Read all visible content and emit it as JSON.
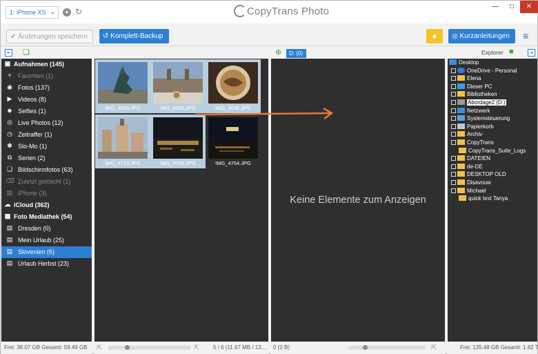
{
  "titlebar": {
    "device": "1: iPhone XS",
    "app_title": "CopyTrans Photo"
  },
  "toolbar": {
    "save_label": "Änderungen speichern",
    "backup_label": "Komplett-Backup",
    "guides_label": "Kurzanleitungen"
  },
  "dest_tab": "D: (0)",
  "explorer_label": "Explorer",
  "left_list": [
    {
      "label": "Aufnahmen (145)",
      "icon": "camera-roll-icon",
      "style": "bold"
    },
    {
      "label": "Favoriten (1)",
      "icon": "heart-icon",
      "style": "dim"
    },
    {
      "label": "Fotos (137)",
      "icon": "camera-icon",
      "style": "normal"
    },
    {
      "label": "Videos (8)",
      "icon": "video-icon",
      "style": "normal"
    },
    {
      "label": "Selfies (1)",
      "icon": "selfie-icon",
      "style": "normal"
    },
    {
      "label": "Live Photos (12)",
      "icon": "live-photo-icon",
      "style": "normal"
    },
    {
      "label": "Zeitraffer (1)",
      "icon": "timelapse-icon",
      "style": "normal"
    },
    {
      "label": "Slo-Mo (1)",
      "icon": "slomo-icon",
      "style": "normal"
    },
    {
      "label": "Serien (2)",
      "icon": "burst-icon",
      "style": "normal"
    },
    {
      "label": "Bildschirmfotos (63)",
      "icon": "screenshot-icon",
      "style": "normal"
    },
    {
      "label": "Zuletzt gelöscht (1)",
      "icon": "trash-icon",
      "style": "dim"
    },
    {
      "label": "iPhone (3)",
      "icon": "album-icon",
      "style": "dim"
    },
    {
      "label": "iCloud (362)",
      "icon": "cloud-icon",
      "style": "bold"
    },
    {
      "label": "Foto Mediathek (54)",
      "icon": "library-icon",
      "style": "bold"
    },
    {
      "label": "Dresden (0)",
      "icon": "album-icon",
      "style": "normal"
    },
    {
      "label": "Mein Urlaub (25)",
      "icon": "album-icon",
      "style": "normal"
    },
    {
      "label": "Slovenien (6)",
      "icon": "album-icon",
      "style": "selected"
    },
    {
      "label": "Urlaub Herbst (23)",
      "icon": "album-icon",
      "style": "normal"
    }
  ],
  "photos": [
    {
      "name": "IMG_4693.JPG",
      "selected": true
    },
    {
      "name": "IMG_4695.JPG",
      "selected": true
    },
    {
      "name": "IMG_4696.JPG",
      "selected": true
    },
    {
      "name": "IMG_4713.JPG",
      "selected": true
    },
    {
      "name": "IMG_4753.JPG",
      "selected": true
    },
    {
      "name": "IMG_4754.JPG",
      "selected": false
    }
  ],
  "empty_message": "Keine Elemente zum Anzeigen",
  "explorer_tree": [
    {
      "label": "Desktop",
      "icon": "desktop-icon",
      "level": 0
    },
    {
      "label": "OneDrive - Personal",
      "icon": "onedrive-icon",
      "level": 1
    },
    {
      "label": "Elena",
      "icon": "user-folder-icon",
      "level": 1
    },
    {
      "label": "Dieser PC",
      "icon": "pc-icon",
      "level": 1
    },
    {
      "label": "Bibliotheken",
      "icon": "folder-icon",
      "level": 1
    },
    {
      "label": "Abordage2 (D:)",
      "icon": "drive-icon",
      "level": 1,
      "selected": true
    },
    {
      "label": "Netzwerk",
      "icon": "network-icon",
      "level": 1
    },
    {
      "label": "Systemsteuerung",
      "icon": "control-panel-icon",
      "level": 1
    },
    {
      "label": "Papierkorb",
      "icon": "recycle-bin-icon",
      "level": 1
    },
    {
      "label": "Archiv",
      "icon": "folder-icon",
      "level": 1
    },
    {
      "label": "CopyTrans",
      "icon": "folder-icon",
      "level": 1
    },
    {
      "label": "CopyTrans_Suite_Logs",
      "icon": "folder-icon",
      "level": 1,
      "no_checkbox": true
    },
    {
      "label": "DATEIEN",
      "icon": "folder-icon",
      "level": 1
    },
    {
      "label": "de-DE",
      "icon": "folder-icon",
      "level": 1
    },
    {
      "label": "DESKTOP OLD",
      "icon": "folder-icon",
      "level": 1
    },
    {
      "label": "Disavouw",
      "icon": "folder-icon",
      "level": 1
    },
    {
      "label": "Michael",
      "icon": "folder-icon",
      "level": 1
    },
    {
      "label": "quick text Tanya",
      "icon": "folder-icon",
      "level": 1,
      "no_checkbox": true
    }
  ],
  "status": {
    "left_free": "Frei: 38.07 GB Gesamt: 59.49 GB",
    "src_count": "5 / 6 (11.67 MB / 13....",
    "dst_count": "0 (0 B)",
    "right_free": "Frei: 135.48 GB Gesamt: 1.82 TB"
  },
  "colors": {
    "accent": "#2d7fd3",
    "panel": "#2f2f2f",
    "selected_thumb": "#b8cfe0",
    "bulb": "#f6c22a",
    "arrow": "#e8763a",
    "close": "#c7392a"
  }
}
